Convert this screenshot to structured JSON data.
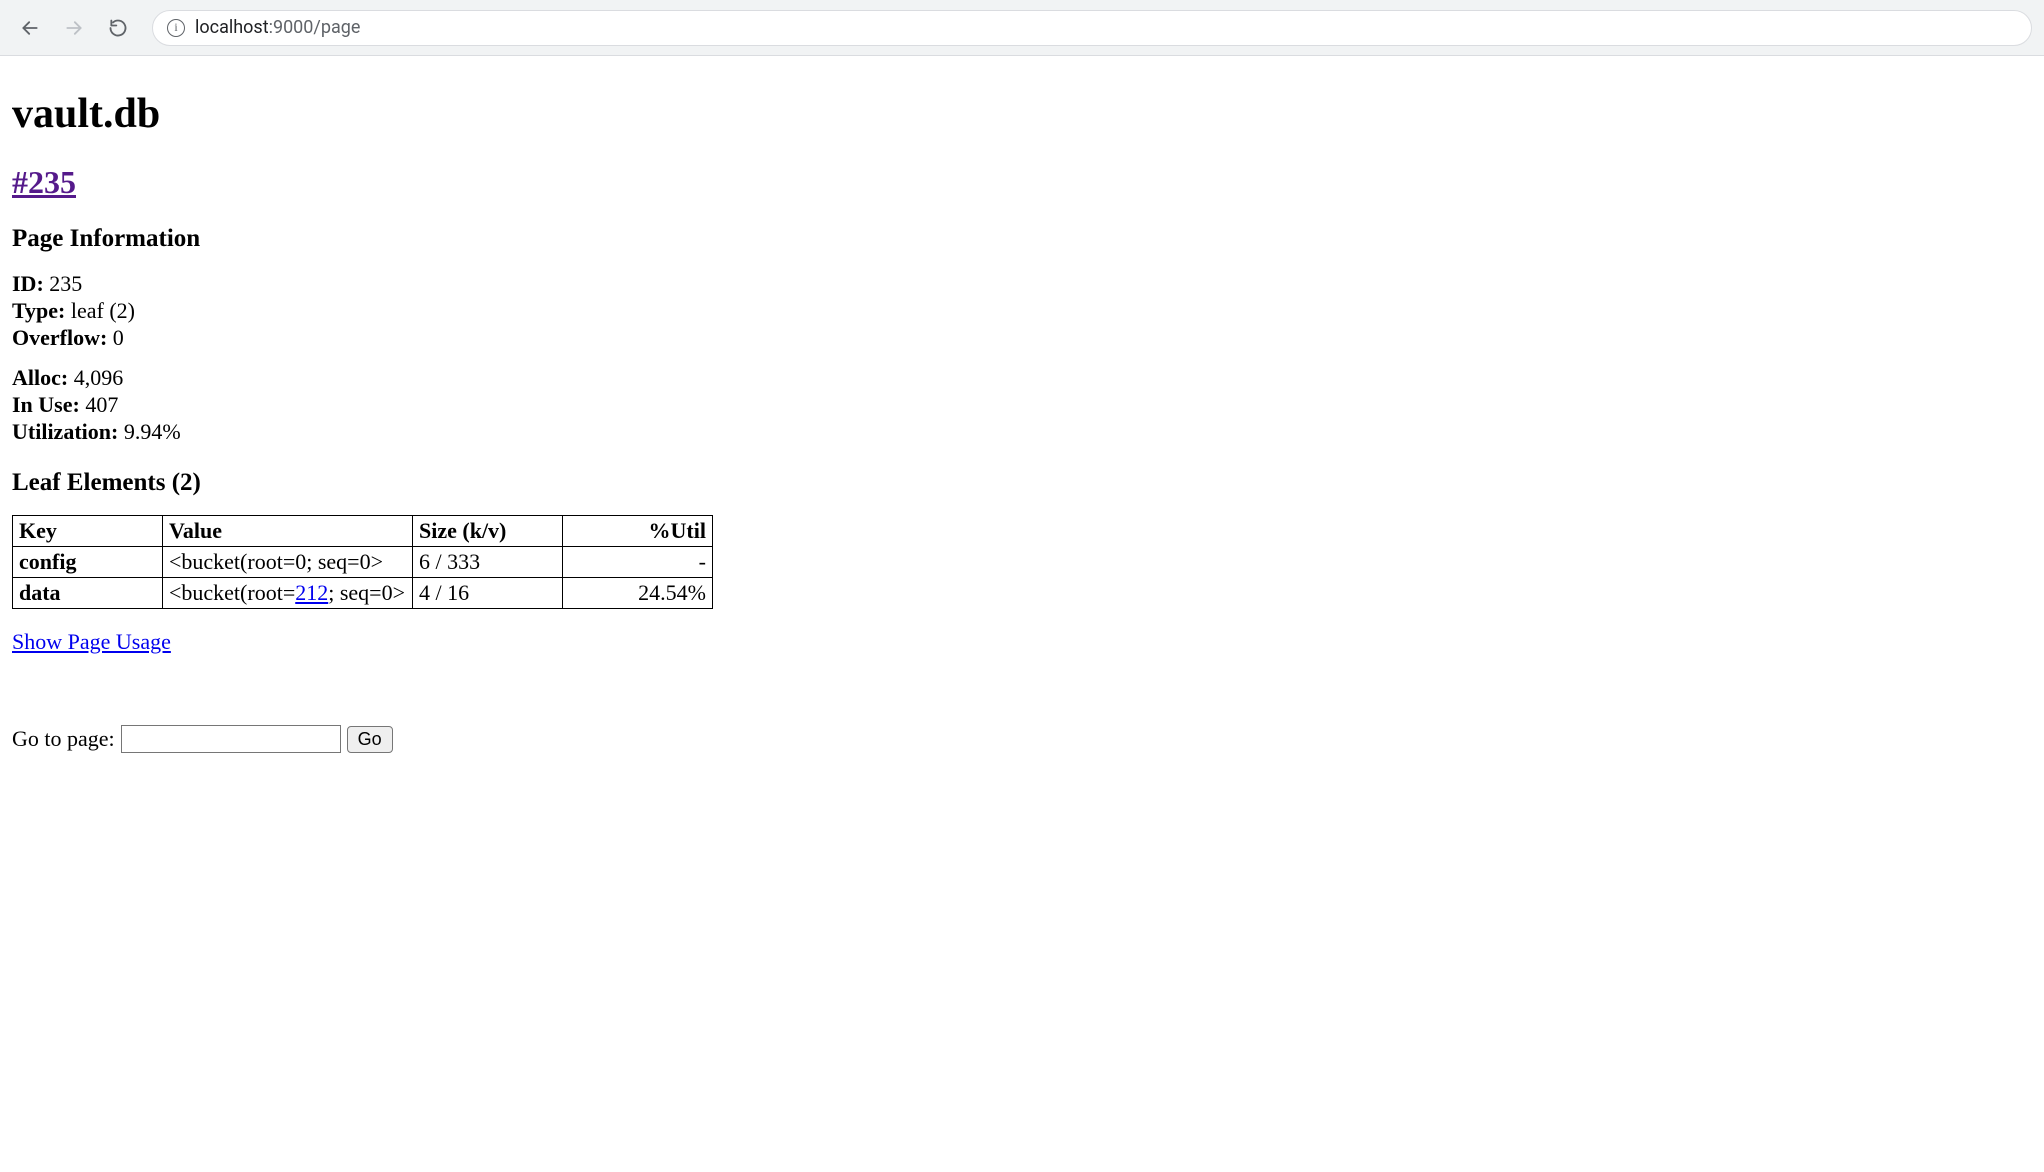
{
  "browser": {
    "url_host": "localhost",
    "url_port_path": ":9000/page"
  },
  "title": "vault.db",
  "breadcrumb": "#235",
  "pageInfoHeading": "Page Information",
  "info": {
    "id_label": "ID:",
    "id_value": "235",
    "type_label": "Type:",
    "type_value": "leaf (2)",
    "overflow_label": "Overflow:",
    "overflow_value": "0",
    "alloc_label": "Alloc:",
    "alloc_value": "4,096",
    "inuse_label": "In Use:",
    "inuse_value": "407",
    "util_label": "Utilization:",
    "util_value": "9.94%"
  },
  "leafHeading": "Leaf Elements (2)",
  "table": {
    "headers": {
      "key": "Key",
      "value": "Value",
      "size": "Size (k/v)",
      "util": "%Util"
    },
    "rows": [
      {
        "key": "config",
        "value_prefix": "<bucket(root=0; seq=0>",
        "value_link": "",
        "value_suffix": "",
        "size": "6 / 333",
        "util": "-"
      },
      {
        "key": "data",
        "value_prefix": "<bucket(root=",
        "value_link": "212",
        "value_suffix": "; seq=0>",
        "size": "4 / 16",
        "util": "24.54%"
      }
    ]
  },
  "showUsageLink": "Show Page Usage",
  "form": {
    "label": "Go to page:",
    "button": "Go"
  }
}
